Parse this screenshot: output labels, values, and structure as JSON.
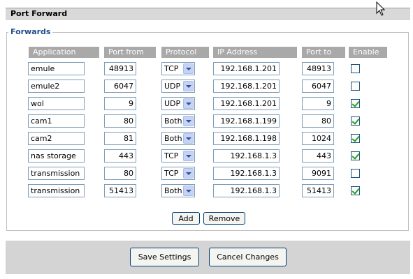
{
  "panel": {
    "title": "Port Forward"
  },
  "forwards": {
    "legend": "Forwards",
    "headers": {
      "application": "Application",
      "port_from": "Port from",
      "protocol": "Protocol",
      "ip_address": "IP Address",
      "port_to": "Port to",
      "enable": "Enable"
    },
    "rows": [
      {
        "application": "emule",
        "port_from": "48913",
        "protocol": "TCP",
        "ip": "192.168.1.201",
        "port_to": "48913",
        "enabled": false
      },
      {
        "application": "emule2",
        "port_from": "6047",
        "protocol": "UDP",
        "ip": "192.168.1.201",
        "port_to": "6047",
        "enabled": false
      },
      {
        "application": "wol",
        "port_from": "9",
        "protocol": "UDP",
        "ip": "192.168.1.201",
        "port_to": "9",
        "enabled": true
      },
      {
        "application": "cam1",
        "port_from": "80",
        "protocol": "Both",
        "ip": "192.168.1.199",
        "port_to": "80",
        "enabled": true
      },
      {
        "application": "cam2",
        "port_from": "81",
        "protocol": "Both",
        "ip": "192.168.1.198",
        "port_to": "1024",
        "enabled": true
      },
      {
        "application": "nas storage",
        "port_from": "443",
        "protocol": "TCP",
        "ip": "192.168.1.3",
        "port_to": "443",
        "enabled": true
      },
      {
        "application": "transmission",
        "port_from": "80",
        "protocol": "TCP",
        "ip": "192.168.1.3",
        "port_to": "9091",
        "enabled": false
      },
      {
        "application": "transmission",
        "port_from": "51413",
        "protocol": "Both",
        "ip": "192.168.1.3",
        "port_to": "51413",
        "enabled": true
      }
    ],
    "add_label": "Add",
    "remove_label": "Remove"
  },
  "footer": {
    "save_label": "Save Settings",
    "cancel_label": "Cancel Changes"
  },
  "icons": {
    "cursor": "mouse-pointer-icon",
    "dropdown": "chevron-down-icon",
    "check": "check-icon"
  },
  "colors": {
    "legend": "#1f4e8c",
    "header_bg": "#a9a9a9",
    "check": "#21a121",
    "footer_bg": "#d4d4d4"
  }
}
